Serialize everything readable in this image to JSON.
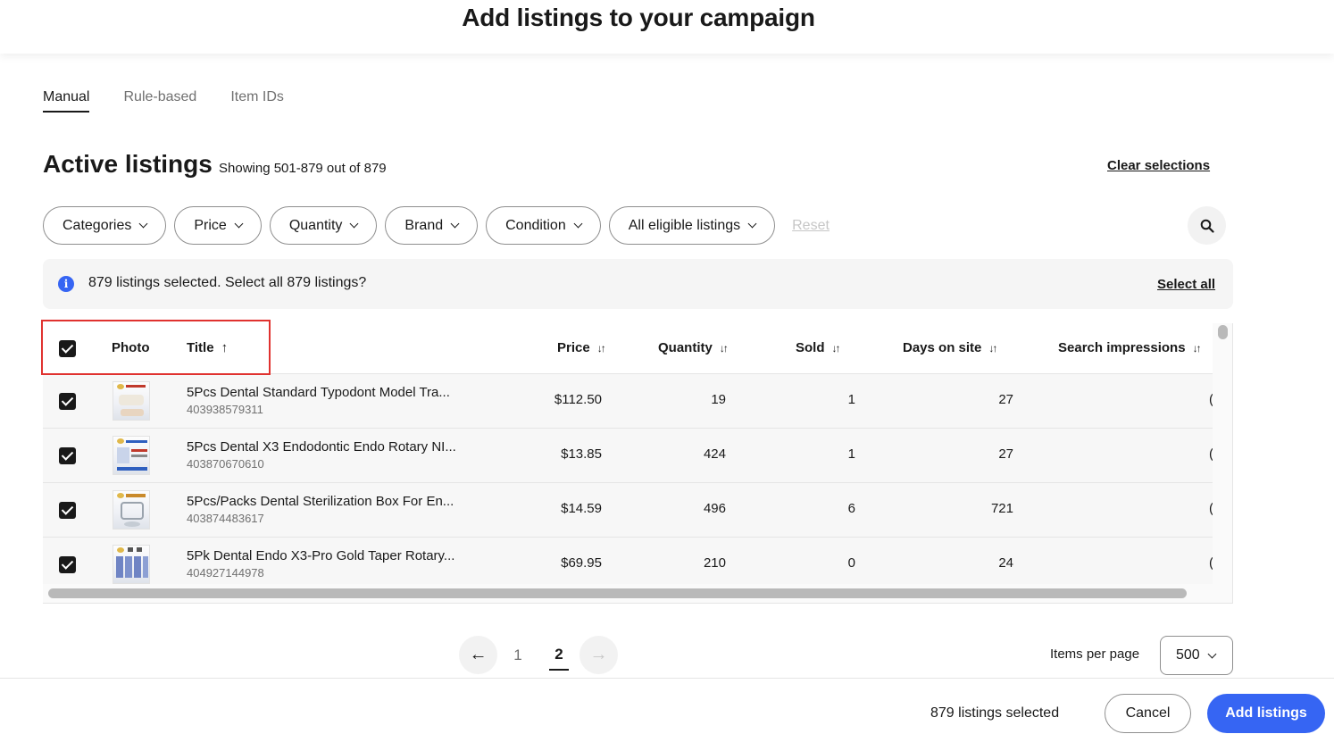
{
  "header": {
    "title": "Add listings to your campaign"
  },
  "tabs": [
    {
      "label": "Manual",
      "active": true
    },
    {
      "label": "Rule-based",
      "active": false
    },
    {
      "label": "Item IDs",
      "active": false
    }
  ],
  "section": {
    "title": "Active listings",
    "showing": "Showing 501-879 out of 879",
    "clear_selections": "Clear selections"
  },
  "filters": {
    "categories": "Categories",
    "price": "Price",
    "quantity": "Quantity",
    "brand": "Brand",
    "condition": "Condition",
    "eligibility": "All eligible listings",
    "reset": "Reset"
  },
  "banner": {
    "icon": "info-icon",
    "text": "879 listings selected. Select all 879 listings?",
    "select_all": "Select all"
  },
  "table": {
    "columns": {
      "photo": "Photo",
      "title": "Title",
      "price": "Price",
      "quantity": "Quantity",
      "sold": "Sold",
      "days_on_site": "Days on site",
      "search_impressions": "Search impressions"
    },
    "rows": [
      {
        "title": "5Pcs Dental Standard Typodont Model Tra...",
        "item_id": "403938579311",
        "price": "$112.50",
        "quantity": "19",
        "sold": "1",
        "days": "27",
        "impressions": "("
      },
      {
        "title": "5Pcs Dental X3 Endodontic Endo Rotary NI...",
        "item_id": "403870670610",
        "price": "$13.85",
        "quantity": "424",
        "sold": "1",
        "days": "27",
        "impressions": "("
      },
      {
        "title": "5Pcs/Packs Dental Sterilization Box For En...",
        "item_id": "403874483617",
        "price": "$14.59",
        "quantity": "496",
        "sold": "6",
        "days": "721",
        "impressions": "("
      },
      {
        "title": "5Pk Dental Endo X3-Pro Gold Taper Rotary...",
        "item_id": "404927144978",
        "price": "$69.95",
        "quantity": "210",
        "sold": "0",
        "days": "24",
        "impressions": "("
      }
    ]
  },
  "pagination": {
    "pages": [
      "1",
      "2"
    ],
    "current": "2",
    "items_per_page_label": "Items per page",
    "items_per_page_value": "500"
  },
  "footer": {
    "selected_count": "879 listings selected",
    "cancel": "Cancel",
    "add": "Add listings"
  },
  "colors": {
    "accent": "#3665f3",
    "highlight": "#e0322f"
  }
}
